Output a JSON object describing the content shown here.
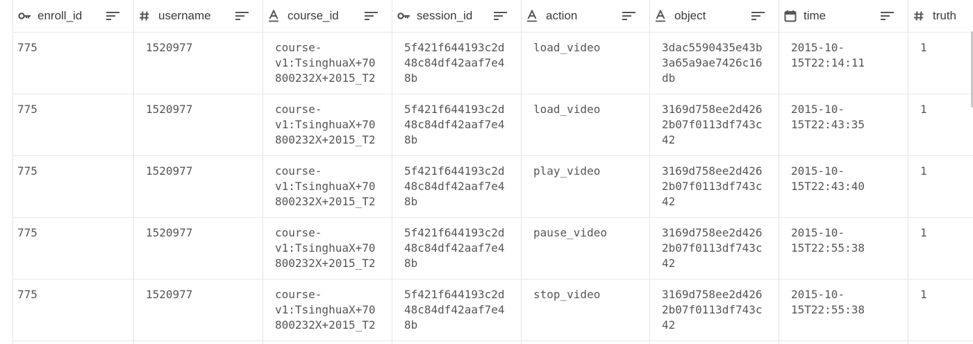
{
  "columns": [
    {
      "key": "enroll_id",
      "label": "enroll_id",
      "icon": "key-icon"
    },
    {
      "key": "username",
      "label": "username",
      "icon": "hash-icon"
    },
    {
      "key": "course_id",
      "label": "course_id",
      "icon": "text-icon"
    },
    {
      "key": "session_id",
      "label": "session_id",
      "icon": "key-icon"
    },
    {
      "key": "action",
      "label": "action",
      "icon": "text-icon"
    },
    {
      "key": "object",
      "label": "object",
      "icon": "text-icon"
    },
    {
      "key": "time",
      "label": "time",
      "icon": "calendar-icon"
    },
    {
      "key": "truth",
      "label": "truth",
      "icon": "hash-icon"
    }
  ],
  "rows": [
    {
      "enroll_id": "775",
      "username": "1520977",
      "course_id": "course-v1:TsinghuaX+70800232X+2015_T2",
      "session_id": "5f421f644193c2d48c84df42aaf7e48b",
      "action": "load_video",
      "object": "3dac5590435e43b3a65a9ae7426c16db",
      "time": "2015-10-15T22:14:11",
      "truth": "1"
    },
    {
      "enroll_id": "775",
      "username": "1520977",
      "course_id": "course-v1:TsinghuaX+70800232X+2015_T2",
      "session_id": "5f421f644193c2d48c84df42aaf7e48b",
      "action": "load_video",
      "object": "3169d758ee2d4262b07f0113df743c42",
      "time": "2015-10-15T22:43:35",
      "truth": "1"
    },
    {
      "enroll_id": "775",
      "username": "1520977",
      "course_id": "course-v1:TsinghuaX+70800232X+2015_T2",
      "session_id": "5f421f644193c2d48c84df42aaf7e48b",
      "action": "play_video",
      "object": "3169d758ee2d4262b07f0113df743c42",
      "time": "2015-10-15T22:43:40",
      "truth": "1"
    },
    {
      "enroll_id": "775",
      "username": "1520977",
      "course_id": "course-v1:TsinghuaX+70800232X+2015_T2",
      "session_id": "5f421f644193c2d48c84df42aaf7e48b",
      "action": "pause_video",
      "object": "3169d758ee2d4262b07f0113df743c42",
      "time": "2015-10-15T22:55:38",
      "truth": "1"
    },
    {
      "enroll_id": "775",
      "username": "1520977",
      "course_id": "course-v1:TsinghuaX+70800232X+2015_T2",
      "session_id": "5f421f644193c2d48c84df42aaf7e48b",
      "action": "stop_video",
      "object": "3169d758ee2d4262b07f0113df743c42",
      "time": "2015-10-15T22:55:38",
      "truth": "1"
    }
  ],
  "display_lines": [
    {
      "enroll_id": [
        "775"
      ],
      "username": [
        "1520977"
      ],
      "course_id": [
        "course-",
        "v1:TsinghuaX+70",
        "800232X+2015_T2"
      ],
      "session_id": [
        "5f421f644193c2d",
        "48c84df42aaf7e4",
        "8b"
      ],
      "action": [
        "load_video"
      ],
      "object": [
        "3dac5590435e43b",
        "3a65a9ae7426c16",
        "db"
      ],
      "time": [
        "2015-10-",
        "15T22:14:11"
      ],
      "truth": [
        "1"
      ]
    },
    {
      "enroll_id": [
        "775"
      ],
      "username": [
        "1520977"
      ],
      "course_id": [
        "course-",
        "v1:TsinghuaX+70",
        "800232X+2015_T2"
      ],
      "session_id": [
        "5f421f644193c2d",
        "48c84df42aaf7e4",
        "8b"
      ],
      "action": [
        "load_video"
      ],
      "object": [
        "3169d758ee2d426",
        "2b07f0113df743c",
        "42"
      ],
      "time": [
        "2015-10-",
        "15T22:43:35"
      ],
      "truth": [
        "1"
      ]
    },
    {
      "enroll_id": [
        "775"
      ],
      "username": [
        "1520977"
      ],
      "course_id": [
        "course-",
        "v1:TsinghuaX+70",
        "800232X+2015_T2"
      ],
      "session_id": [
        "5f421f644193c2d",
        "48c84df42aaf7e4",
        "8b"
      ],
      "action": [
        "play_video"
      ],
      "object": [
        "3169d758ee2d426",
        "2b07f0113df743c",
        "42"
      ],
      "time": [
        "2015-10-",
        "15T22:43:40"
      ],
      "truth": [
        "1"
      ]
    },
    {
      "enroll_id": [
        "775"
      ],
      "username": [
        "1520977"
      ],
      "course_id": [
        "course-",
        "v1:TsinghuaX+70",
        "800232X+2015_T2"
      ],
      "session_id": [
        "5f421f644193c2d",
        "48c84df42aaf7e4",
        "8b"
      ],
      "action": [
        "pause_video"
      ],
      "object": [
        "3169d758ee2d426",
        "2b07f0113df743c",
        "42"
      ],
      "time": [
        "2015-10-",
        "15T22:55:38"
      ],
      "truth": [
        "1"
      ]
    },
    {
      "enroll_id": [
        "775"
      ],
      "username": [
        "1520977"
      ],
      "course_id": [
        "course-",
        "v1:TsinghuaX+70",
        "800232X+2015_T2"
      ],
      "session_id": [
        "5f421f644193c2d",
        "48c84df42aaf7e4",
        "8b"
      ],
      "action": [
        "stop_video"
      ],
      "object": [
        "3169d758ee2d426",
        "2b07f0113df743c",
        "42"
      ],
      "time": [
        "2015-10-",
        "15T22:55:38"
      ],
      "truth": [
        "1"
      ]
    }
  ],
  "colors": {
    "header_text": "#3a3a3a",
    "cell_text": "#555555",
    "icon": "#555555",
    "grid": "#e5e5e5"
  }
}
